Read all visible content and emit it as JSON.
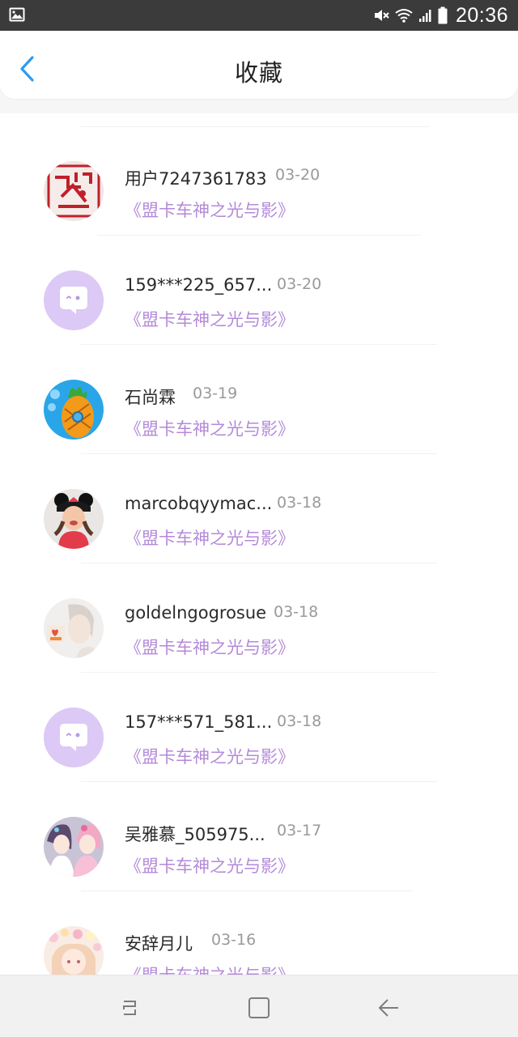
{
  "status_bar": {
    "time": "20:36",
    "icons": [
      "gallery-icon",
      "mute-icon",
      "wifi-icon",
      "signal-icon",
      "battery-icon"
    ]
  },
  "header": {
    "title": "收藏",
    "back_icon": "chevron-left-icon"
  },
  "colors": {
    "accent": "#2d9cf0",
    "book_title": "#b38ad8",
    "default_avatar_bg": "#dcc9f5"
  },
  "items": [
    {
      "username": "用户7247361783",
      "date": "03-20",
      "book": "《盟卡车神之光与影》",
      "avatar": "photo-red-drawing"
    },
    {
      "username": "159***225_657...",
      "date": "03-20",
      "book": "《盟卡车神之光与影》",
      "avatar": "default-chat-bubble"
    },
    {
      "username": "石尚霖",
      "date": "03-19",
      "book": "《盟卡车神之光与影》",
      "avatar": "photo-pineapple-house"
    },
    {
      "username": "marcobqyymac...",
      "date": "03-18",
      "book": "《盟卡车神之光与影》",
      "avatar": "photo-girl-mouse-ears"
    },
    {
      "username": "goldelngogrosue",
      "date": "03-18",
      "book": "《盟卡车神之光与影》",
      "avatar": "photo-person-soft"
    },
    {
      "username": "157***571_581...",
      "date": "03-18",
      "book": "《盟卡车神之光与影》",
      "avatar": "default-chat-bubble"
    },
    {
      "username": "吴雅慕_505975...",
      "date": "03-17",
      "book": "《盟卡车神之光与影》",
      "avatar": "photo-anime-girls"
    },
    {
      "username": "安辞月儿",
      "date": "03-16",
      "book": "《盟卡车神之光与影》",
      "avatar": "photo-anime-flowers"
    }
  ],
  "nav_bar": {
    "buttons": [
      "recent-apps-icon",
      "home-icon",
      "back-icon"
    ]
  }
}
